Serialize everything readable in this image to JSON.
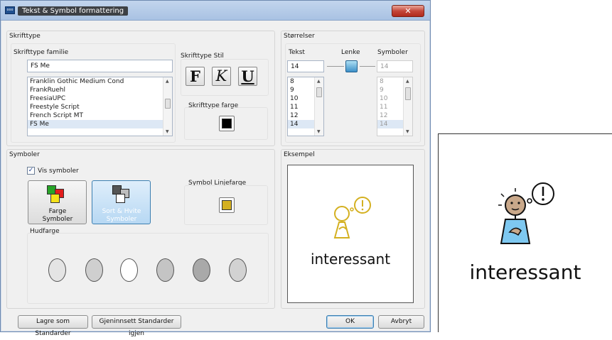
{
  "window": {
    "title": "Tekst & Symbol formattering",
    "close_glyph": "✕",
    "app_icon_text": "ooo"
  },
  "font_group": {
    "label": "Skrifttype",
    "family_label": "Skrifttype familie",
    "family_value": "FS Me",
    "family_list": [
      "Franklin Gothic Medium Cond",
      "FrankRuehl",
      "FreesiaUPC",
      "Freestyle Script",
      "French Script MT",
      "FS Me"
    ],
    "selected_family": "FS Me",
    "style_label": "Skrifttype Stil",
    "bold": "F",
    "italic": "K",
    "underline": "U",
    "color_label": "Skrifttype farge",
    "color": "#000000"
  },
  "sizes_group": {
    "label": "Størrelser",
    "text_label": "Tekst",
    "link_label": "Lenke",
    "symbols_label": "Symboler",
    "text_value": "14",
    "symbols_value": "14",
    "text_list": [
      "8",
      "9",
      "10",
      "11",
      "12",
      "14"
    ],
    "symbols_list": [
      "8",
      "9",
      "10",
      "11",
      "12",
      "14"
    ]
  },
  "symbols_group": {
    "label": "Symboler",
    "show_symbols_label": "Vis symboler",
    "show_symbols_checked": true,
    "color_symbols_label": "Farge Symboler",
    "bw_symbols_label": "Sort & Hvite Symboler",
    "line_color_label": "Symbol Linjefarge",
    "line_color": "#d4b020",
    "skin_label": "Hudfarge",
    "skin_colors": [
      "#e4e4e4",
      "#cfcfcf",
      "#ffffff",
      "#c4c4c4",
      "#a9a9a9",
      "#d2d2d2"
    ]
  },
  "example_group": {
    "label": "Eksempel",
    "word": "interessant"
  },
  "footer": {
    "save_default": "Lagre som Standarder",
    "reset_default": "Gjeninnsett Standarder igjen",
    "ok": "OK",
    "cancel": "Avbryt"
  },
  "preview_card": {
    "word": "interessant"
  }
}
